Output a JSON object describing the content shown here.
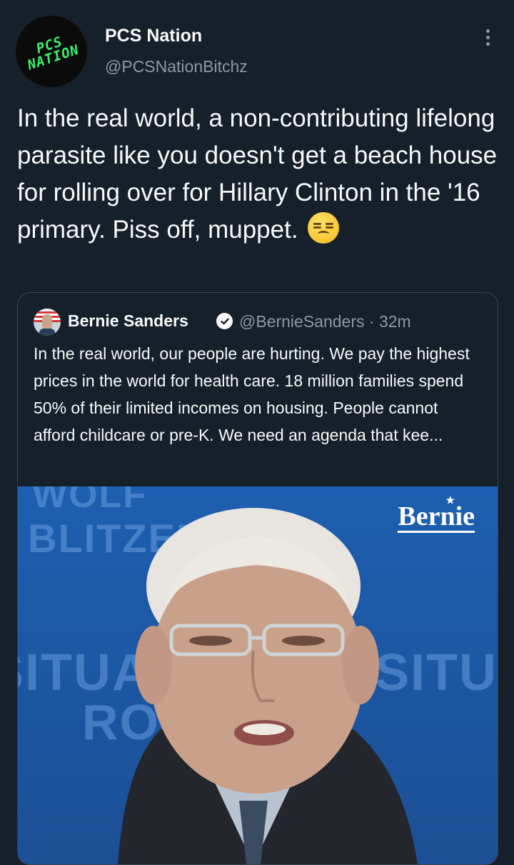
{
  "author": {
    "avatar_text": "PCS NATION",
    "name": "PCS Nation",
    "handle": "@PCSNationBitchz"
  },
  "tweet": {
    "text": "In the real world, a non-contributing lifelong parasite like you doesn't get a beach house for rolling over for Hillary Clinton in the '16 primary. Piss off, muppet.",
    "emoji": "unamused-face"
  },
  "quote": {
    "name": "Bernie Sanders",
    "handle_time": "@BernieSanders · 32m",
    "text": "In the real world, our people are hurting. We pay the highest prices in the world for health care. 18 million families spend 50% of their limited incomes on housing. People cannot afford childcare or pre-K. We need an agenda that kee...",
    "media": {
      "logo_text": "Bernie",
      "background_text": [
        "WOLF",
        "BLITZER",
        "SITUATION",
        "ROOM"
      ]
    }
  },
  "colors": {
    "background": "#15202b",
    "text": "#f7f9f9",
    "secondary": "#8b98a5",
    "border": "#38444d",
    "media_blue": "#1d5fb0"
  }
}
